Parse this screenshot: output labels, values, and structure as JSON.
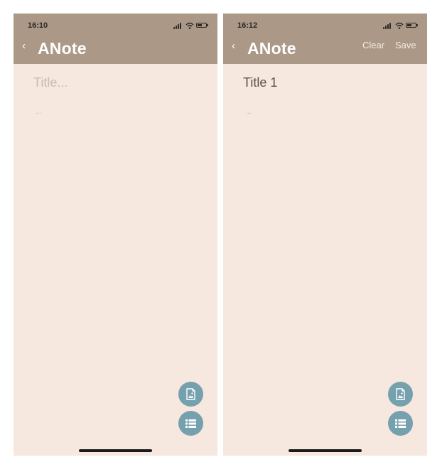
{
  "screens": [
    {
      "status_time": "16:10",
      "app_title": "ANote",
      "title_placeholder": "Title...",
      "title_value": "",
      "body_placeholder": "...",
      "actions": []
    },
    {
      "status_time": "16:12",
      "app_title": "ANote",
      "title_placeholder": "Title...",
      "title_value": "Title 1",
      "body_placeholder": "...",
      "actions": [
        "Clear",
        "Save"
      ]
    }
  ],
  "icons": {
    "back": "chevron-left-icon",
    "signal": "cellular-signal-icon",
    "wifi": "wifi-icon",
    "battery": "battery-icon",
    "add_image": "image-file-icon",
    "checklist": "list-icon"
  },
  "colors": {
    "header": "#ab9886",
    "background": "#f6e7df",
    "fab": "#75a0ae",
    "placeholder": "#c9bcae",
    "title_text": "#5b5149"
  }
}
